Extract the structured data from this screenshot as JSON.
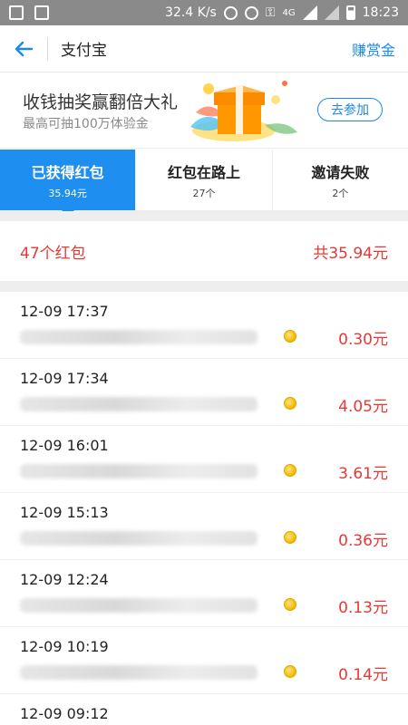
{
  "status_bar": {
    "speed": "32.4 K/s",
    "network": "4G",
    "time": "18:23"
  },
  "header": {
    "title": "支付宝",
    "action": "赚赏金"
  },
  "banner": {
    "title": "收钱抽奖赢翻倍大礼",
    "subtitle": "最高可抽100万体验金",
    "join_label": "去参加"
  },
  "tabs": [
    {
      "label": "已获得红包",
      "count": "35.94元",
      "active": true
    },
    {
      "label": "红包在路上",
      "count": "27个",
      "active": false
    },
    {
      "label": "邀请失败",
      "count": "2个",
      "active": false
    }
  ],
  "summary": {
    "count": "47个红包",
    "total": "共35.94元"
  },
  "records": [
    {
      "time": "12-09 17:37",
      "amount": "0.30元"
    },
    {
      "time": "12-09 17:34",
      "amount": "4.05元"
    },
    {
      "time": "12-09 16:01",
      "amount": "3.61元"
    },
    {
      "time": "12-09 15:13",
      "amount": "0.36元"
    },
    {
      "time": "12-09 12:24",
      "amount": "0.13元"
    },
    {
      "time": "12-09 10:19",
      "amount": "0.14元"
    },
    {
      "time": "12-09 09:12",
      "amount": ""
    }
  ],
  "colors": {
    "accent": "#1e8ef0",
    "amount_red": "#e53935",
    "status_bar": "#8a8a8a"
  }
}
